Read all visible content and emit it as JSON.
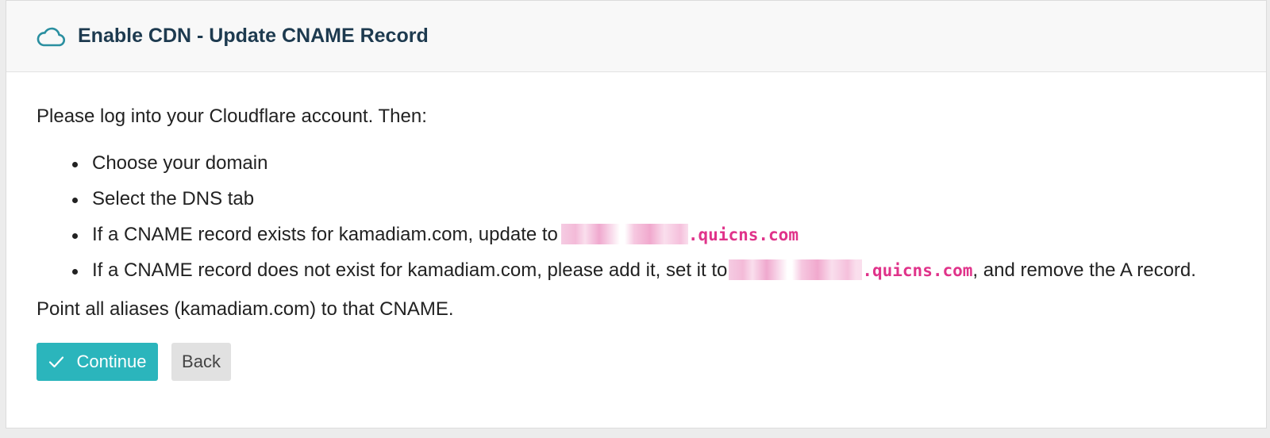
{
  "header": {
    "icon": "cloud-icon",
    "title": "Enable CDN - Update CNAME Record"
  },
  "body": {
    "intro": "Please log into your Cloudflare account. Then:",
    "steps": [
      {
        "text": "Choose your domain"
      },
      {
        "text": "Select the DNS tab"
      },
      {
        "text_before": "If a CNAME record exists for kamadiam.com, update to",
        "code": ".quicns.com",
        "text_after": ""
      },
      {
        "text_before": "If a CNAME record does not exist for kamadiam.com, please add it, set it to",
        "code": ".quicns.com",
        "text_after": ", and remove the A record."
      }
    ],
    "outro": "Point all aliases (kamadiam.com) to that CNAME."
  },
  "actions": {
    "continue_label": "Continue",
    "continue_icon": "check-icon",
    "back_label": "Back"
  },
  "colors": {
    "accent": "#2bb5bc",
    "title": "#1d3a4f",
    "code": "#e0338a"
  }
}
